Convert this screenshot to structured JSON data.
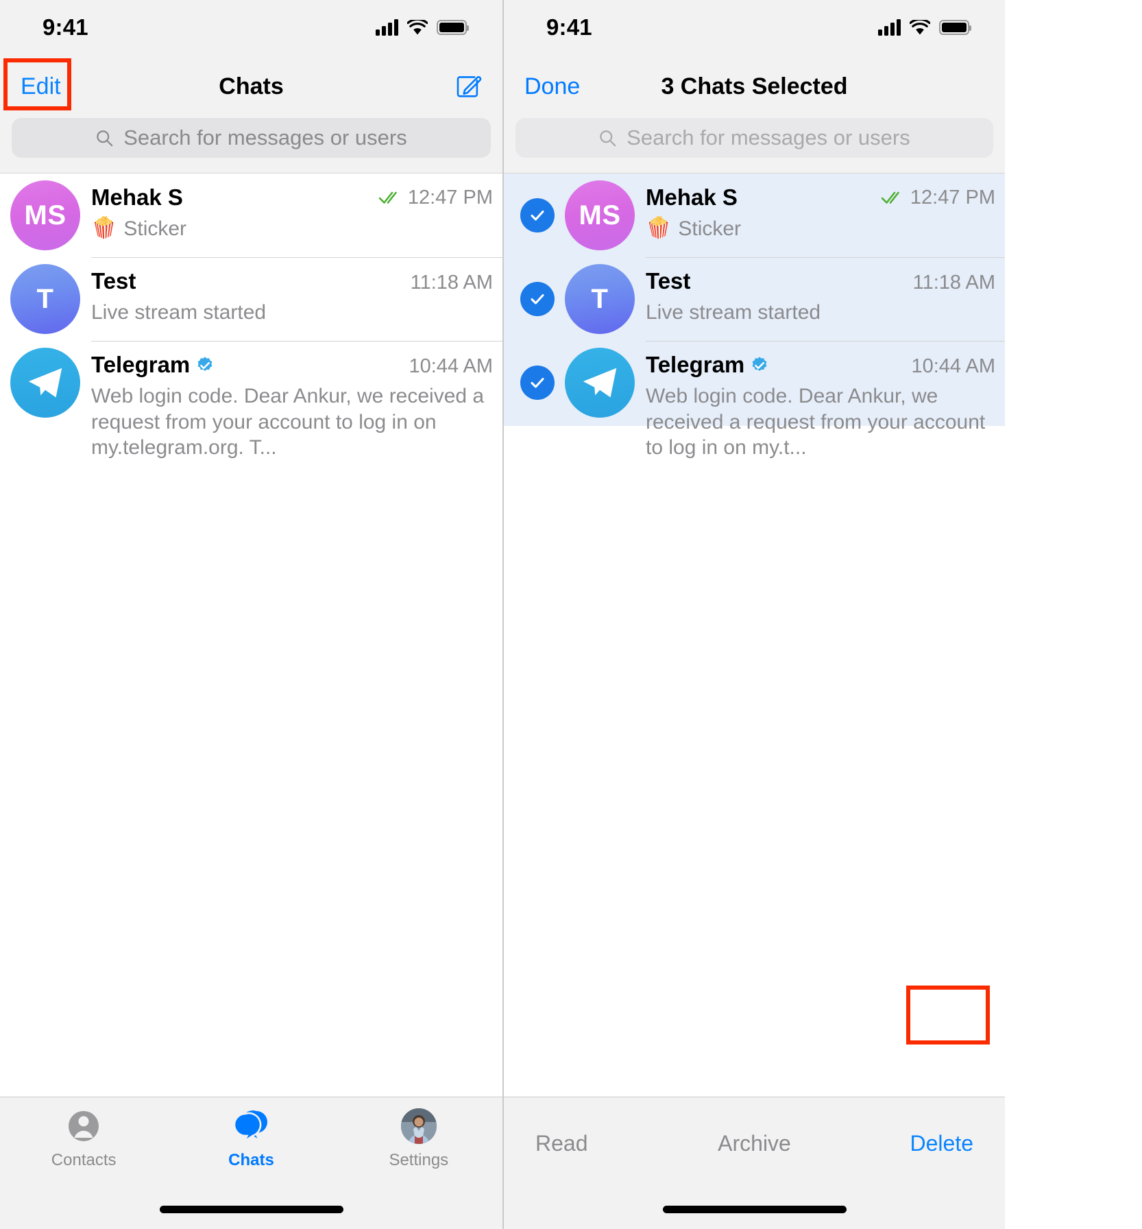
{
  "status_bar": {
    "time": "9:41",
    "signal_icon": "cellular-signal-icon",
    "wifi_icon": "wifi-icon",
    "battery_icon": "battery-icon"
  },
  "left_screen": {
    "nav": {
      "left_button": "Edit",
      "title": "Chats",
      "right_icon": "compose-icon"
    },
    "search": {
      "placeholder": "Search for messages or users",
      "icon": "search-icon"
    },
    "chats": [
      {
        "avatar_initials": "MS",
        "avatar_type": "initials",
        "name": "Mehak S",
        "verified": false,
        "preview_emoji": "🍿",
        "preview": "Sticker",
        "time": "12:47 PM",
        "read_receipt": true
      },
      {
        "avatar_initials": "T",
        "avatar_type": "initials",
        "name": "Test",
        "verified": false,
        "preview_emoji": "",
        "preview": "Live stream started",
        "time": "11:18 AM",
        "read_receipt": false
      },
      {
        "avatar_initials": "",
        "avatar_type": "telegram-logo",
        "name": "Telegram",
        "verified": true,
        "preview_emoji": "",
        "preview": "Web login code. Dear Ankur, we received a request from your account to log in on my.telegram.org. T...",
        "time": "10:44 AM",
        "read_receipt": false
      }
    ],
    "tab_bar": [
      {
        "label": "Contacts",
        "icon": "contacts-person-icon",
        "active": false
      },
      {
        "label": "Chats",
        "icon": "chats-bubbles-icon",
        "active": true
      },
      {
        "label": "Settings",
        "icon": "settings-avatar-photo",
        "active": false
      }
    ]
  },
  "right_screen": {
    "nav": {
      "left_button": "Done",
      "title": "3 Chats Selected"
    },
    "search": {
      "placeholder": "Search for messages or users",
      "icon": "search-icon"
    },
    "chats": [
      {
        "avatar_initials": "MS",
        "avatar_type": "initials",
        "name": "Mehak S",
        "verified": false,
        "preview_emoji": "🍿",
        "preview": "Sticker",
        "time": "12:47 PM",
        "read_receipt": true,
        "selected": true
      },
      {
        "avatar_initials": "T",
        "avatar_type": "initials",
        "name": "Test",
        "verified": false,
        "preview_emoji": "",
        "preview": "Live stream started",
        "time": "11:18 AM",
        "read_receipt": false,
        "selected": true
      },
      {
        "avatar_initials": "",
        "avatar_type": "telegram-logo",
        "name": "Telegram",
        "verified": true,
        "preview_emoji": "",
        "preview": "Web login code. Dear Ankur, we received a request from your account to log in on my.t...",
        "time": "10:44 AM",
        "read_receipt": false,
        "selected": true
      }
    ],
    "action_bar": {
      "read": "Read",
      "archive": "Archive",
      "delete": "Delete"
    }
  },
  "annotations": {
    "highlight_color": "#fa2b00",
    "highlight_targets": [
      "Edit",
      "Delete"
    ]
  },
  "colors": {
    "accent_blue": "#007aff",
    "link_blue": "#0a84ff",
    "checkbox_blue": "#1b79e8",
    "selected_row_bg": "#e6eef9",
    "read_receipt_green": "#4caf30",
    "secondary_text": "#8b8b8e"
  }
}
